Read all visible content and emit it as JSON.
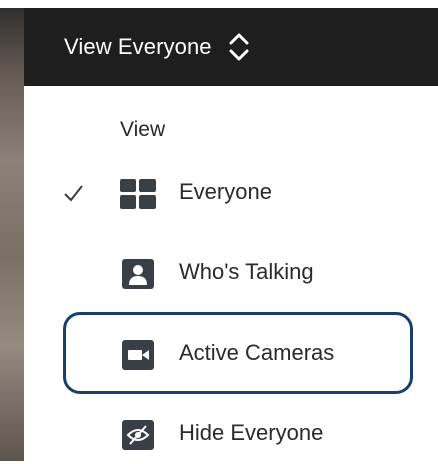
{
  "header": {
    "view_label": "View Everyone",
    "toggle_icon": "chevron-updown-icon"
  },
  "menu": {
    "section_title": "View",
    "items": [
      {
        "label": "Everyone",
        "icon": "grid-icon",
        "checked": true
      },
      {
        "label": "Who's Talking",
        "icon": "person-icon",
        "checked": false
      },
      {
        "label": "Active Cameras",
        "icon": "camera-icon",
        "checked": false,
        "focused": true
      },
      {
        "label": "Hide Everyone",
        "icon": "eye-slash-icon",
        "checked": false
      }
    ]
  },
  "colors": {
    "header_bg": "#1e1e1e",
    "icon_fill": "#3a3f45",
    "focus_ring": "#16406a",
    "text": "#2a2a2a"
  }
}
